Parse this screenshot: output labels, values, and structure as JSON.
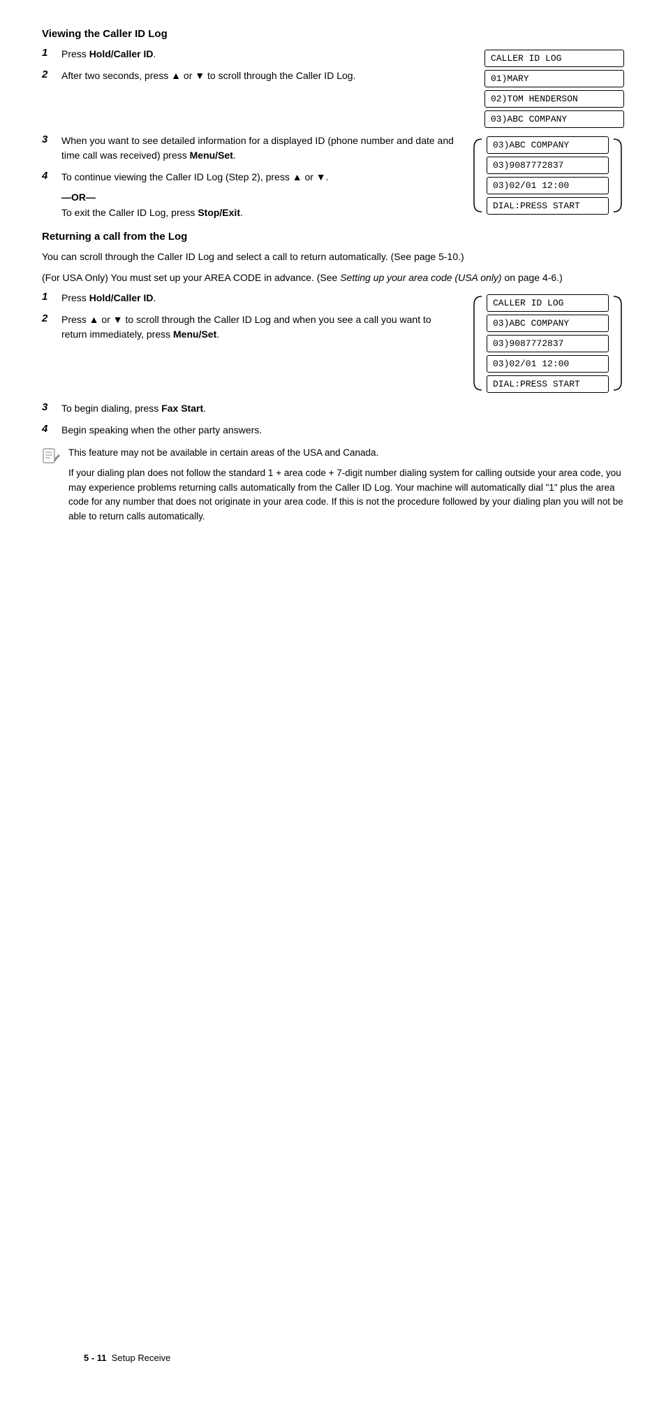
{
  "page": {
    "section1": {
      "title": "Viewing the Caller ID Log",
      "steps": [
        {
          "number": "1",
          "text_before": "Press ",
          "bold": "Hold/Caller ID",
          "text_after": "."
        },
        {
          "number": "2",
          "text": "After two seconds, press ▲ or ▼ to scroll through the Caller ID Log."
        },
        {
          "number": "3",
          "text_before": "When you want to see detailed information for a displayed ID (phone number and date and time call was received) press ",
          "bold": "Menu/Set",
          "text_after": "."
        },
        {
          "number": "4",
          "text_before": "To continue viewing the Caller ID Log (Step 2), press ▲ or ▼."
        }
      ],
      "or_text": "—OR—",
      "exit_text_before": "To exit the Caller ID Log, press ",
      "exit_bold": "Stop/Exit",
      "exit_text_after": ".",
      "display1": {
        "lines": [
          "CALLER ID LOG",
          "01)MARY",
          "02)TOM HENDERSON",
          "03)ABC COMPANY"
        ]
      },
      "display2": {
        "lines": [
          "03)ABC COMPANY",
          "03)9087772837",
          "03)02/01 12:00",
          "DIAL:PRESS START"
        ]
      }
    },
    "section2": {
      "title": "Returning a call from the Log",
      "para1": "You can scroll through the Caller ID Log and select a call to return automatically. (See page 5-10.)",
      "para2_before": "(For USA Only) You must set up your AREA CODE in advance. (See ",
      "para2_italic": "Setting up your area code (USA only)",
      "para2_after": " on page 4-6.)",
      "steps": [
        {
          "number": "1",
          "text_before": "Press ",
          "bold": "Hold/Caller ID",
          "text_after": "."
        },
        {
          "number": "2",
          "text_before": "Press ▲ or ▼ to scroll through the Caller ID Log and when you see a call you want to return immediately, press ",
          "bold": "Menu/Set",
          "text_after": "."
        },
        {
          "number": "3",
          "text_before": "To begin dialing, press ",
          "bold": "Fax Start",
          "text_after": "."
        },
        {
          "number": "4",
          "text": "Begin speaking when the other party answers."
        }
      ],
      "display1": {
        "lines": [
          "CALLER ID LOG",
          "03)ABC COMPANY",
          "03)9087772837",
          "03)02/01 12:00",
          "DIAL:PRESS START"
        ]
      },
      "note1": "This feature may not be available in certain areas of the USA and Canada.",
      "note2": "If your dialing plan does not follow the standard 1 + area code + 7-digit number dialing system for calling outside your area code, you may experience problems returning calls automatically from the Caller ID Log. Your machine will automatically dial \"1\" plus the area code for any number that does not originate in your area code. If this is not the procedure followed by your dialing plan you will not be able to return calls automatically."
    },
    "footer": {
      "page": "5 - 11",
      "text": "Setup Receive"
    }
  }
}
